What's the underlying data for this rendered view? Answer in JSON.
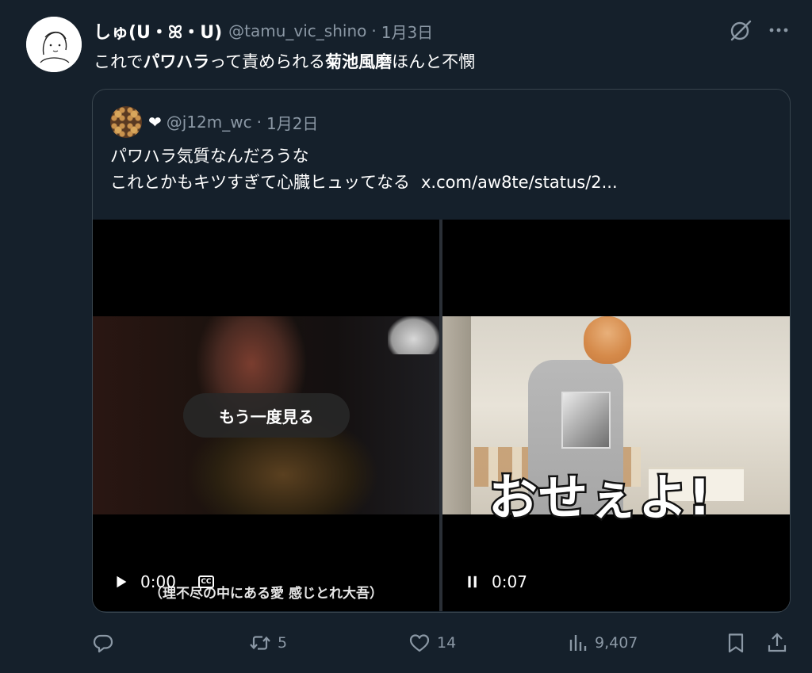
{
  "tweet": {
    "name": "しゅ(U・ꕤ・U)",
    "handle": "@tamu_vic_shino",
    "separator": "·",
    "date": "1月3日",
    "text_segments": [
      {
        "text": "これで",
        "bold": false
      },
      {
        "text": "パワハラ",
        "bold": true
      },
      {
        "text": "って責められる",
        "bold": false
      },
      {
        "text": "菊池風磨",
        "bold": true
      },
      {
        "text": "ほんと不憫",
        "bold": false
      }
    ],
    "icons": {
      "grok": "grok-icon",
      "more": "more-icon"
    }
  },
  "quote": {
    "heart": "❤",
    "handle": "@j12m_wc",
    "separator": "·",
    "date": "1月2日",
    "line1": "パワハラ気質なんだろうな",
    "line2": "これとかもキツすぎて心臓ヒュッてなる",
    "link": "x.com/aw8te/status/2..."
  },
  "media": {
    "left": {
      "replay_label": "もう一度見る",
      "subtitle": "（理不尽の中にある愛 感じとれ大吾）",
      "time": "0:00",
      "cc_label": "CC",
      "state": "play"
    },
    "right": {
      "caption": "おせぇよ!",
      "time": "0:07",
      "state": "pause"
    }
  },
  "actions": {
    "reply": {
      "icon": "reply-icon",
      "count": ""
    },
    "retweet": {
      "icon": "retweet-icon",
      "count": "5"
    },
    "like": {
      "icon": "heart-icon",
      "count": "14"
    },
    "views": {
      "icon": "views-icon",
      "count": "9,407"
    },
    "bookmark": {
      "icon": "bookmark-icon"
    },
    "share": {
      "icon": "share-icon"
    }
  },
  "colors": {
    "background": "#15202b",
    "secondary_text": "#8b98a5",
    "border": "#38444d"
  }
}
